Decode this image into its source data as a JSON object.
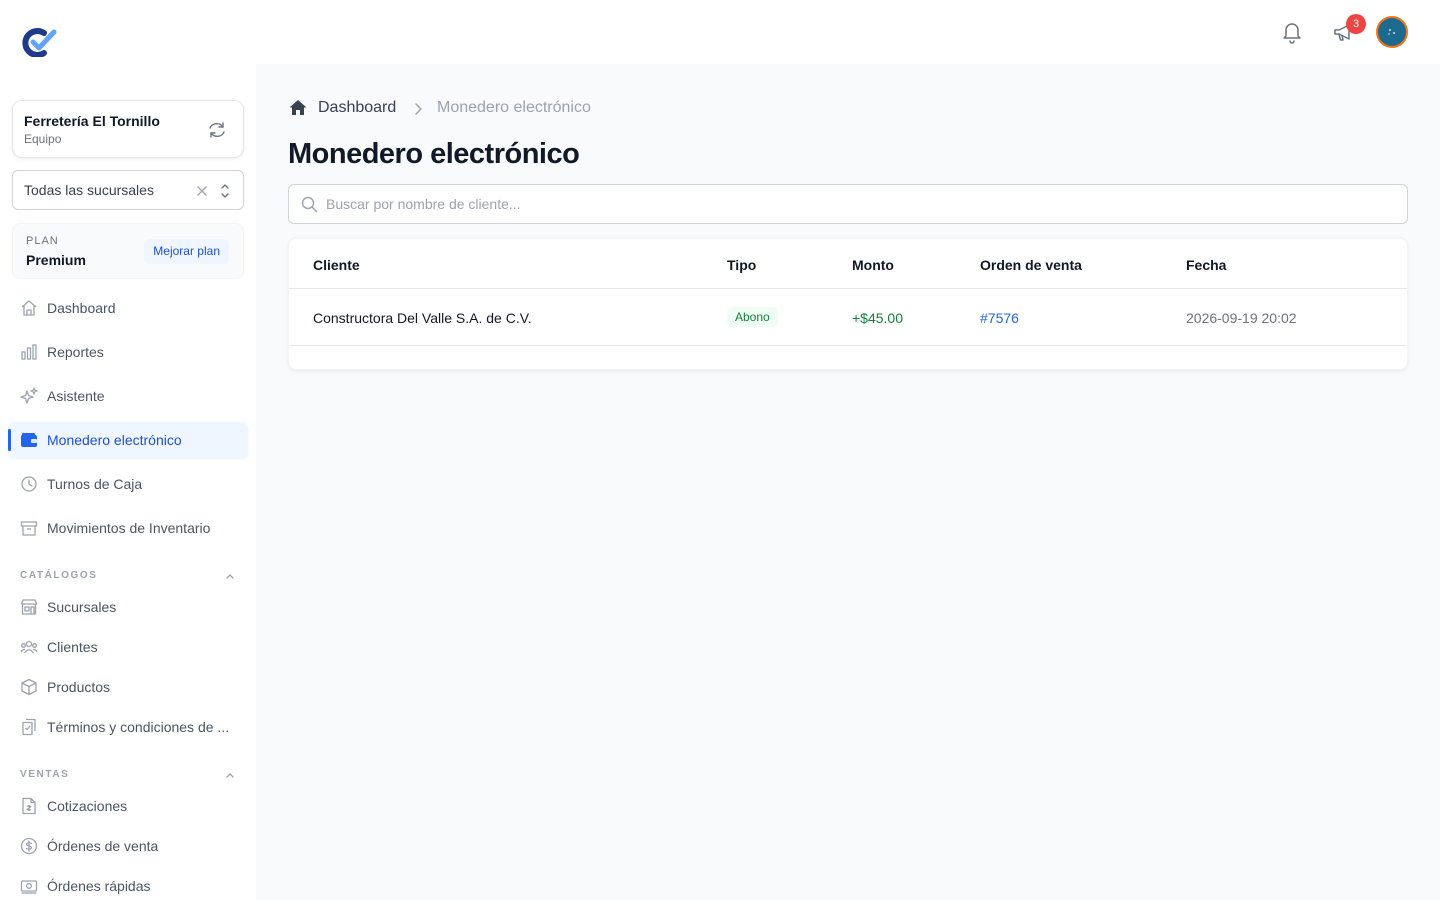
{
  "sidebar": {
    "team": {
      "name": "Ferretería El Tornillo",
      "role": "Equipo"
    },
    "branch_select": {
      "value": "Todas las sucursales"
    },
    "plan": {
      "label": "PLAN",
      "name": "Premium",
      "upgrade_label": "Mejorar plan"
    },
    "nav": [
      {
        "label": "Dashboard",
        "icon": "home-icon"
      },
      {
        "label": "Reportes",
        "icon": "bar-chart-icon"
      },
      {
        "label": "Asistente",
        "icon": "sparkles-icon"
      },
      {
        "label": "Monedero electrónico",
        "icon": "wallet-icon",
        "active": true
      },
      {
        "label": "Turnos de Caja",
        "icon": "clock-icon"
      },
      {
        "label": "Movimientos de Inventario",
        "icon": "archive-icon"
      }
    ],
    "sections": [
      {
        "title": "CATÁLOGOS",
        "items": [
          {
            "label": "Sucursales",
            "icon": "store-icon"
          },
          {
            "label": "Clientes",
            "icon": "users-icon"
          },
          {
            "label": "Productos",
            "icon": "cube-icon"
          },
          {
            "label": "Términos y condiciones de ...",
            "icon": "document-icon"
          }
        ]
      },
      {
        "title": "VENTAS",
        "items": [
          {
            "label": "Cotizaciones",
            "icon": "quote-doc-icon"
          },
          {
            "label": "Órdenes de venta",
            "icon": "dollar-circle-icon"
          },
          {
            "label": "Órdenes rápidas",
            "icon": "cash-icon"
          }
        ]
      }
    ]
  },
  "topbar": {
    "notifications_badge": "3"
  },
  "breadcrumb": {
    "home": "Dashboard",
    "current": "Monedero electrónico"
  },
  "page": {
    "title": "Monedero electrónico"
  },
  "search": {
    "placeholder": "Buscar por nombre de cliente...",
    "value": ""
  },
  "table": {
    "columns": [
      "Cliente",
      "Tipo",
      "Monto",
      "Orden de venta",
      "Fecha"
    ],
    "rows": [
      {
        "client": "Constructora Del Valle S.A. de C.V.",
        "type": "Abono",
        "amount": "+$45.00",
        "order": "#7576",
        "date": "2026-09-19 20:02"
      }
    ]
  },
  "colors": {
    "accent": "#2563eb",
    "positive": "#15803d",
    "badge": "#ef4444"
  }
}
